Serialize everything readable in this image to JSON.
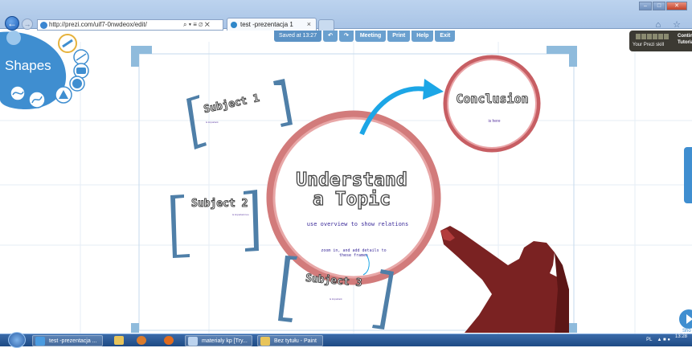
{
  "browser": {
    "url": "http://prezi.com/uif7-0nwdeox/edit/",
    "address_tools": "⌕ ▾ ≡ ∅ ✕",
    "tab_title": "test -prezentacja 1",
    "tab_close": "×",
    "back_icon": "←",
    "forward_icon": "→",
    "window_controls": [
      "–",
      "□",
      "✕"
    ],
    "icons": "⌂ ☆"
  },
  "toolbar": {
    "saved": "Saved at 13:27",
    "undo": "↶",
    "redo": "↷",
    "meeting": "Meeting",
    "print": "Print",
    "help": "Help",
    "exit": "Exit"
  },
  "shapes_menu": {
    "title": "Shapes"
  },
  "canvas": {
    "main_title_line1": "Understand",
    "main_title_line2": "a Topic",
    "main_subtitle": "use overview to show relations",
    "conclusion_title": "Conclusion",
    "conclusion_subtitle": "is here",
    "subjects": [
      {
        "label": "Subject 1",
        "note": "is important"
      },
      {
        "label": "Subject 2",
        "note": "is important too"
      },
      {
        "label": "Subject 3",
        "note": "is important"
      }
    ],
    "zoom_note": "zoom in, and add details to these frames"
  },
  "skill": {
    "label": "Your Prezi skill",
    "continue": "Contin",
    "tutorial": "Tutoria"
  },
  "show": {
    "label": "Sho"
  },
  "taskbar": {
    "tasks": [
      "test -prezentacja ...",
      "materialy kp [Try...",
      "Bez tytułu - Paint"
    ],
    "lang": "PL",
    "time": "13:28"
  },
  "colors": {
    "prezi_blue": "#3f8ed0",
    "circle_red": "#d98787",
    "bracket_blue": "#4f7fa8",
    "arrow_blue": "#1ca6e6",
    "silhouette": "#6b1d1d"
  }
}
